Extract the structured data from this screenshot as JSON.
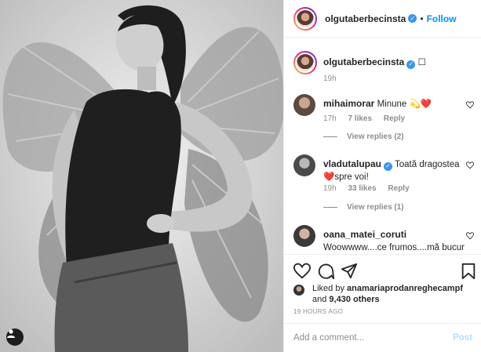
{
  "post": {
    "author": "olgutaberbecinsta",
    "follow_label": "Follow",
    "separator": "•",
    "caption_emoji": "☐",
    "caption_time": "19h",
    "likes_by_prefix": "Liked by",
    "likes_by_user": "anamariaprodanreghecampf",
    "likes_others_joiner": "and",
    "likes_others": "9,430 others",
    "timestamp": "19 HOURS AGO"
  },
  "comments": [
    {
      "user": "mihaimorar",
      "text": "Minune 💫❤️",
      "time": "17h",
      "likes": "7 likes",
      "reply_label": "Reply",
      "view_replies": "View replies (2)"
    },
    {
      "user": "vladutalupau",
      "verified": true,
      "text": "Toată dragostea ❤️spre voi!",
      "time": "19h",
      "likes": "33 likes",
      "reply_label": "Reply",
      "view_replies": "View replies (1)"
    },
    {
      "user": "oana_matei_coruti",
      "text": "Woowwww....ce frumos....mă bucur tare că nu ati lasat-o pe"
    }
  ],
  "composer": {
    "placeholder": "Add a comment...",
    "post_label": "Post"
  },
  "colors": {
    "accent": "#0095f6",
    "verified": "#3897f0",
    "muted": "#8e8e8e",
    "post_disabled": "#b2dffc"
  }
}
